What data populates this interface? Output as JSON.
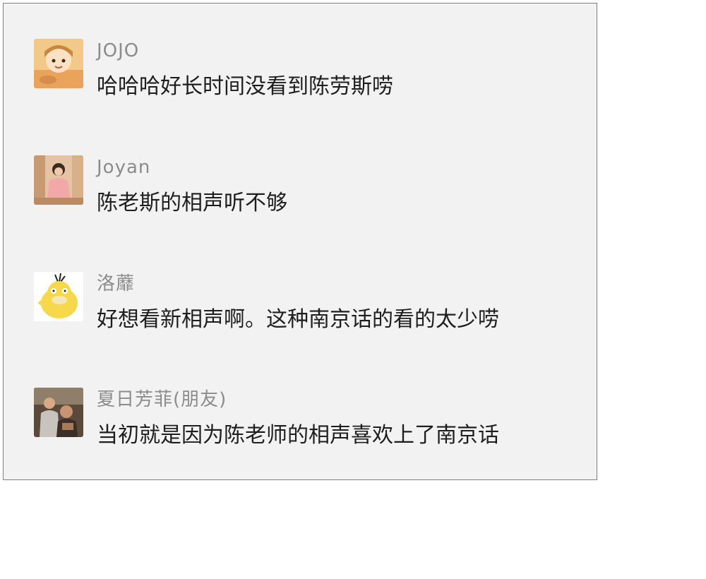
{
  "comments": [
    {
      "user": "JOJO",
      "text": "哈哈哈好长时间没看到陈劳斯唠",
      "avatar_icon": "anime-girl-avatar"
    },
    {
      "user": "Joyan",
      "text": "陈老斯的相声听不够",
      "avatar_icon": "woman-photo-avatar"
    },
    {
      "user": "洛蘼",
      "text": "好想看新相声啊。这种南京话的看的太少唠",
      "avatar_icon": "psyduck-avatar"
    },
    {
      "user": "夏日芳菲(朋友)",
      "text": "当初就是因为陈老师的相声喜欢上了南京话",
      "avatar_icon": "man-photo-avatar"
    }
  ]
}
